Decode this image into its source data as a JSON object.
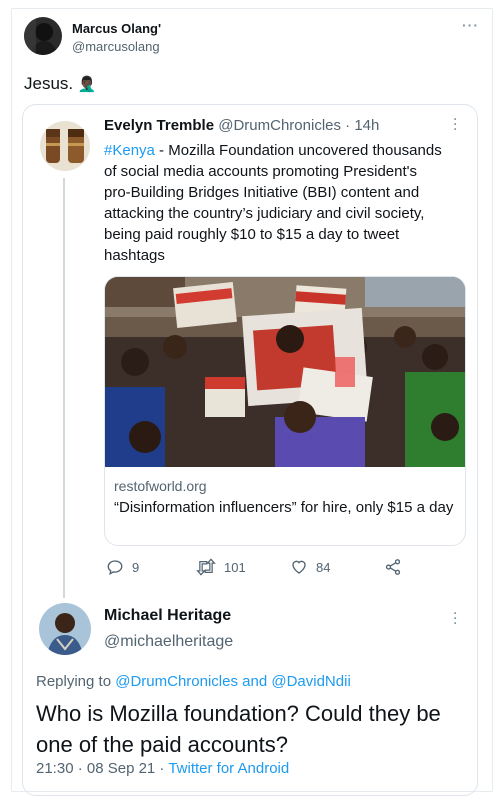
{
  "outer_tweet": {
    "author_name": "Marcus Olang'",
    "author_handle": "@marcusolang",
    "text": "Jesus.",
    "emoji": "🤦🏿‍♂️"
  },
  "quoted_tweet": {
    "author_name": "Evelyn Tremble",
    "author_handle": "@DrumChronicles",
    "time": "· 14h",
    "hashtag": "#Kenya",
    "text": " - Mozilla Foundation uncovered thousands of social media accounts promoting President's pro-Building Bridges Initiative (BBI) content and attacking the country’s judiciary and civil society, being paid roughly $10 to $15 a day to tweet hashtags",
    "card": {
      "domain": "restofworld.org",
      "title": "“Disinformation influencers” for hire, only $15 a day"
    },
    "actions": {
      "replies": "9",
      "retweets": "101",
      "likes": "84"
    }
  },
  "reply_tweet": {
    "author_name": "Michael Heritage",
    "author_handle": "@michaelheritage",
    "replying_prefix": "Replying to ",
    "replying_to_1": "@DrumChronicles",
    "replying_and": " and ",
    "replying_to_2": "@DavidNdii",
    "text": "Who is Mozilla foundation? Could they be one of the paid accounts?",
    "timestamp": "21:30 · 08 Sep 21 · ",
    "client": "Twitter for Android"
  },
  "icons": {
    "more": "more-horizontal-icon",
    "reply": "reply-icon",
    "retweet": "retweet-icon",
    "like": "heart-icon",
    "share": "share-icon"
  },
  "colors": {
    "link": "#1d9bf0",
    "secondary_text": "#536471",
    "border": "#dfe5ea"
  }
}
